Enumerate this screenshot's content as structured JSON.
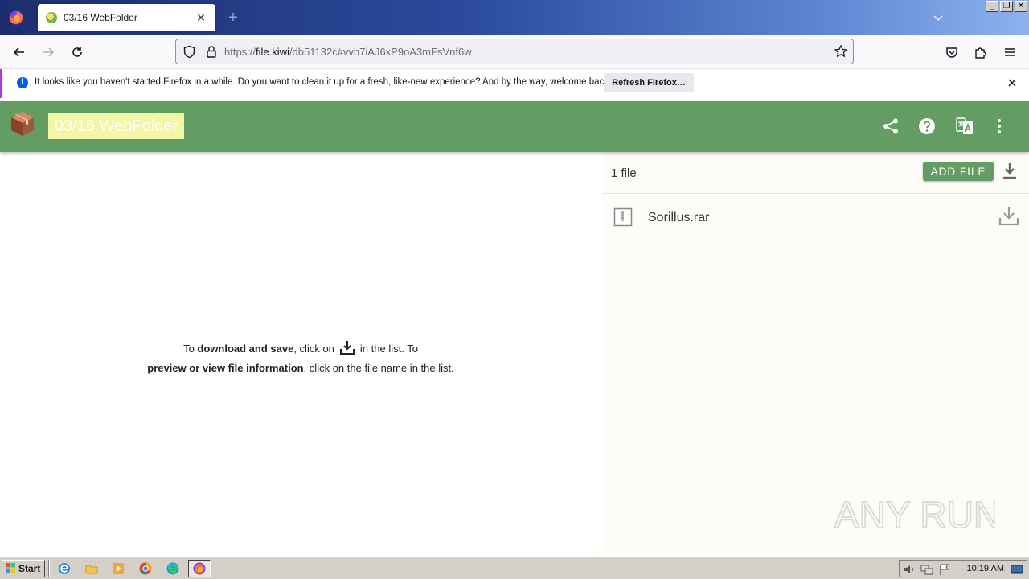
{
  "browser": {
    "tab_title": "03/16 WebFolder",
    "url_scheme": "https://",
    "url_host": "file.kiwi",
    "url_path": "/db51132c#vvh7iAJ6xP9oA3mFsVnf6w",
    "new_tab_label": "+"
  },
  "notification": {
    "message": "It looks like you haven't started Firefox in a while. Do you want to clean it up for a fresh, like-new experience? And by the way, welcome back!",
    "button_label": "Refresh Firefox…"
  },
  "app": {
    "folder_title": "03/16 WebFolder",
    "header_color": "#649d64"
  },
  "hint": {
    "p1": "To ",
    "b1": "download and save",
    "p2": ", click on",
    "p3": "in the list. To",
    "b2": "preview or view file information",
    "p4": ", click on the file name in the list."
  },
  "files": {
    "count_label": "1 file",
    "add_label": "ADD FILE",
    "items": [
      {
        "name": "Sorillus.rar"
      }
    ]
  },
  "watermark": "ANY RUN",
  "taskbar": {
    "start_label": "Start",
    "clock": "10:19 AM"
  }
}
